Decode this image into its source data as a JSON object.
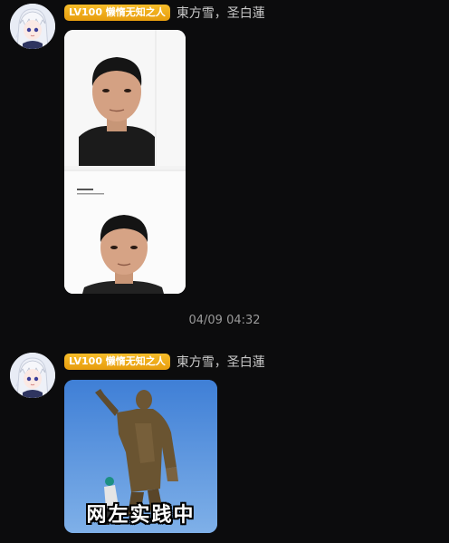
{
  "messages": [
    {
      "badge": "LV100 懒惰无知之人",
      "username": "東方雪，圣白蓮",
      "attachment": "photo-sheet-image"
    },
    {
      "badge": "LV100 懒惰无知之人",
      "username": "東方雪，圣白蓮",
      "attachment": "meme-image",
      "caption": "网左实践中"
    }
  ],
  "timestamp": "04/09 04:32",
  "colors": {
    "background": "#0c0c0d",
    "badge": "#f2b01e",
    "username": "#c9c9c9",
    "timestamp": "#9a9a9a"
  }
}
